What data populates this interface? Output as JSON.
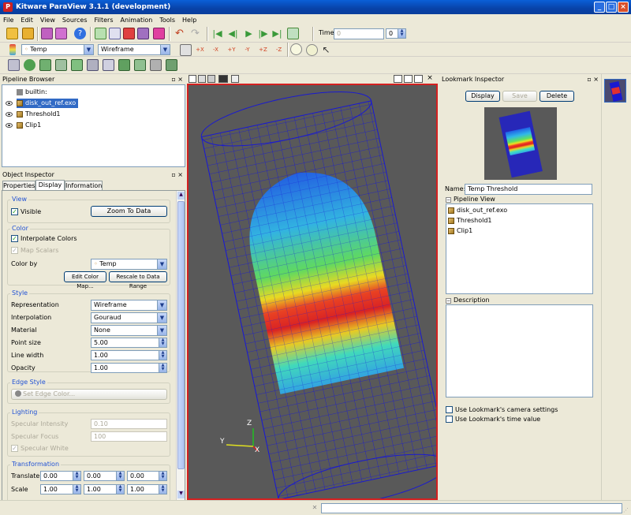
{
  "window": {
    "title": "Kitware ParaView 3.1.1 (development)",
    "logo": "P"
  },
  "menu": [
    "File",
    "Edit",
    "View",
    "Sources",
    "Filters",
    "Animation",
    "Tools",
    "Help"
  ],
  "toolbar": {
    "time_label": "Time:",
    "time_value": "0",
    "time_index": "0",
    "color_by": "Temp",
    "representation": "Wireframe"
  },
  "pipeline_browser": {
    "title": "Pipeline Browser",
    "items": [
      "builtin:",
      "disk_out_ref.exo",
      "Threshold1",
      "Clip1"
    ]
  },
  "object_inspector": {
    "title": "Object Inspector",
    "tabs": [
      "Properties",
      "Display",
      "Information"
    ],
    "view": {
      "group": "View",
      "visible_label": "Visible",
      "zoom_button": "Zoom To Data"
    },
    "color": {
      "group": "Color",
      "interpolate_label": "Interpolate Colors",
      "map_scalars_label": "Map Scalars",
      "color_by_label": "Color by",
      "color_by_value": "Temp",
      "edit_color_map": "Edit Color Map...",
      "rescale": "Rescale to Data Range"
    },
    "style": {
      "group": "Style",
      "rows": [
        {
          "label": "Representation",
          "value": "Wireframe"
        },
        {
          "label": "Interpolation",
          "value": "Gouraud"
        },
        {
          "label": "Material",
          "value": "None"
        },
        {
          "label": "Point size",
          "value": "5.00"
        },
        {
          "label": "Line width",
          "value": "1.00"
        },
        {
          "label": "Opacity",
          "value": "1.00"
        }
      ]
    },
    "edge_style": {
      "group": "Edge Style",
      "button": "Set Edge Color..."
    },
    "lighting": {
      "group": "Lighting",
      "specular_intensity_label": "Specular Intensity",
      "specular_intensity": "0.10",
      "specular_focus_label": "Specular Focus",
      "specular_focus": "100",
      "specular_white": "Specular White"
    },
    "transformation": {
      "group": "Transformation",
      "translate_label": "Translate",
      "translate": [
        "0.00",
        "0.00",
        "0.00"
      ],
      "scale_label": "Scale",
      "scale": [
        "1.00",
        "1.00",
        "1.00"
      ]
    }
  },
  "viewport": {
    "axis_x": "X",
    "axis_y": "Y",
    "axis_z": "Z"
  },
  "lookmark_inspector": {
    "title": "Lookmark Inspector",
    "display_button": "Display",
    "save_button": "Save",
    "delete_button": "Delete",
    "name_label": "Name:",
    "name_value": "Temp Threshold",
    "pipeline_view_label": "Pipeline View",
    "pipeline_items": [
      "disk_out_ref.exo",
      "Threshold1",
      "Clip1"
    ],
    "description_label": "Description",
    "use_camera": "Use Lookmark's camera settings",
    "use_time": "Use Lookmark's time value"
  },
  "colors": {
    "accent": "#2152d4",
    "viewport_bg": "#595959",
    "active_border": "#d42020"
  }
}
